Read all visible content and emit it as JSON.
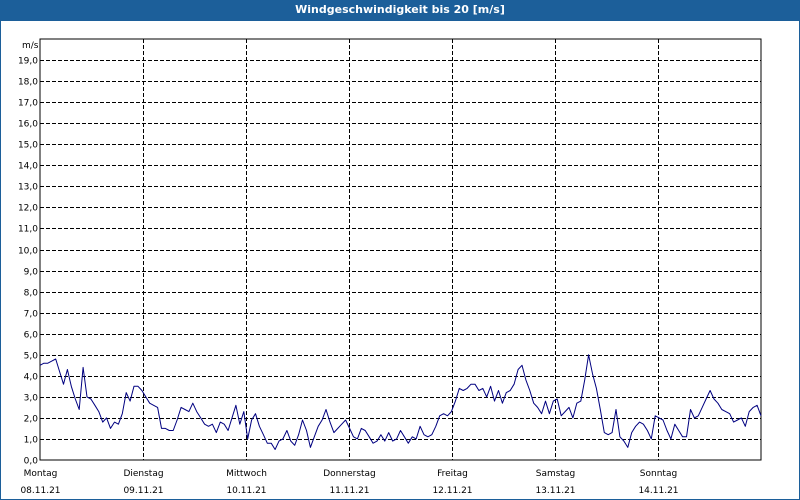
{
  "window": {
    "title": "Windgeschwindigkeit bis 20 [m/s]"
  },
  "chart_data": {
    "type": "line",
    "title": "Windgeschwindigkeit bis 20 [m/s]",
    "ylabel": "m/s",
    "xlabel": "",
    "ylim": [
      0,
      20
    ],
    "y_ticks": [
      "0,0",
      "1,0",
      "2,0",
      "3,0",
      "4,0",
      "5,0",
      "6,0",
      "7,0",
      "8,0",
      "9,0",
      "10,0",
      "11,0",
      "12,0",
      "13,0",
      "14,0",
      "15,0",
      "16,0",
      "17,0",
      "18,0",
      "19,0"
    ],
    "grid": true,
    "colors": {
      "line": "#000080",
      "grid": "#000000",
      "frame_title": "#1c5f9a"
    },
    "days": [
      {
        "day": "Montag",
        "date": "08.11.21"
      },
      {
        "day": "Dienstag",
        "date": "09.11.21"
      },
      {
        "day": "Mittwoch",
        "date": "10.11.21"
      },
      {
        "day": "Donnerstag",
        "date": "11.11.21"
      },
      {
        "day": "Freitag",
        "date": "12.11.21"
      },
      {
        "day": "Samstag",
        "date": "13.11.21"
      },
      {
        "day": "Sonntag",
        "date": "14.11.21"
      }
    ],
    "series": [
      {
        "values": [
          4.5,
          4.6,
          4.6,
          4.7,
          4.8,
          4.2,
          3.6,
          4.3,
          3.5,
          2.9,
          2.4,
          4.4,
          3.0,
          2.9,
          2.6,
          2.3,
          1.8,
          2.0,
          1.5,
          1.8,
          1.7,
          2.2,
          3.2,
          2.8,
          3.5,
          3.5,
          3.3,
          3.0,
          2.7,
          2.6,
          2.5,
          1.5,
          1.5,
          1.4,
          1.4,
          1.9,
          2.5,
          2.4,
          2.3,
          2.7,
          2.3,
          2.0,
          1.7,
          1.6,
          1.7,
          1.3,
          1.8,
          1.7,
          1.4,
          2.0,
          2.6,
          1.7,
          2.3,
          1.0,
          1.9,
          2.2,
          1.6,
          1.2,
          0.8,
          0.8,
          0.5,
          0.9,
          1.0,
          1.4,
          0.9,
          0.7,
          1.2,
          1.9,
          1.4,
          0.6,
          1.1,
          1.6,
          1.9,
          2.4,
          1.8,
          1.3,
          1.5,
          1.7,
          1.9,
          1.5,
          1.1,
          1.0,
          1.5,
          1.4,
          1.1,
          0.8,
          0.9,
          1.2,
          0.9,
          1.3,
          0.9,
          1.0,
          1.4,
          1.1,
          0.8,
          1.1,
          1.0,
          1.6,
          1.2,
          1.1,
          1.2,
          1.6,
          2.1,
          2.2,
          2.1,
          2.3,
          2.8,
          3.4,
          3.3,
          3.4,
          3.6,
          3.6,
          3.3,
          3.4,
          3.0,
          3.5,
          2.8,
          3.3,
          2.7,
          3.2,
          3.3,
          3.6,
          4.3,
          4.5,
          3.8,
          3.3,
          2.7,
          2.5,
          2.2,
          2.8,
          2.2,
          2.8,
          2.9,
          2.1,
          2.3,
          2.5,
          2.0,
          2.7,
          2.8,
          3.8,
          5.0,
          4.1,
          3.4,
          2.4,
          1.3,
          1.2,
          1.3,
          2.4,
          1.1,
          0.9,
          0.6,
          1.3,
          1.6,
          1.8,
          1.7,
          1.4,
          1.0,
          2.1,
          2.0,
          1.9,
          1.4,
          1.0,
          1.7,
          1.4,
          1.1,
          1.1,
          2.4,
          2.0,
          2.1,
          2.5,
          2.9,
          3.3,
          2.9,
          2.7,
          2.4,
          2.3,
          2.2,
          1.8,
          1.9,
          2.0,
          1.6,
          2.3,
          2.5,
          2.6,
          2.1
        ]
      }
    ]
  }
}
